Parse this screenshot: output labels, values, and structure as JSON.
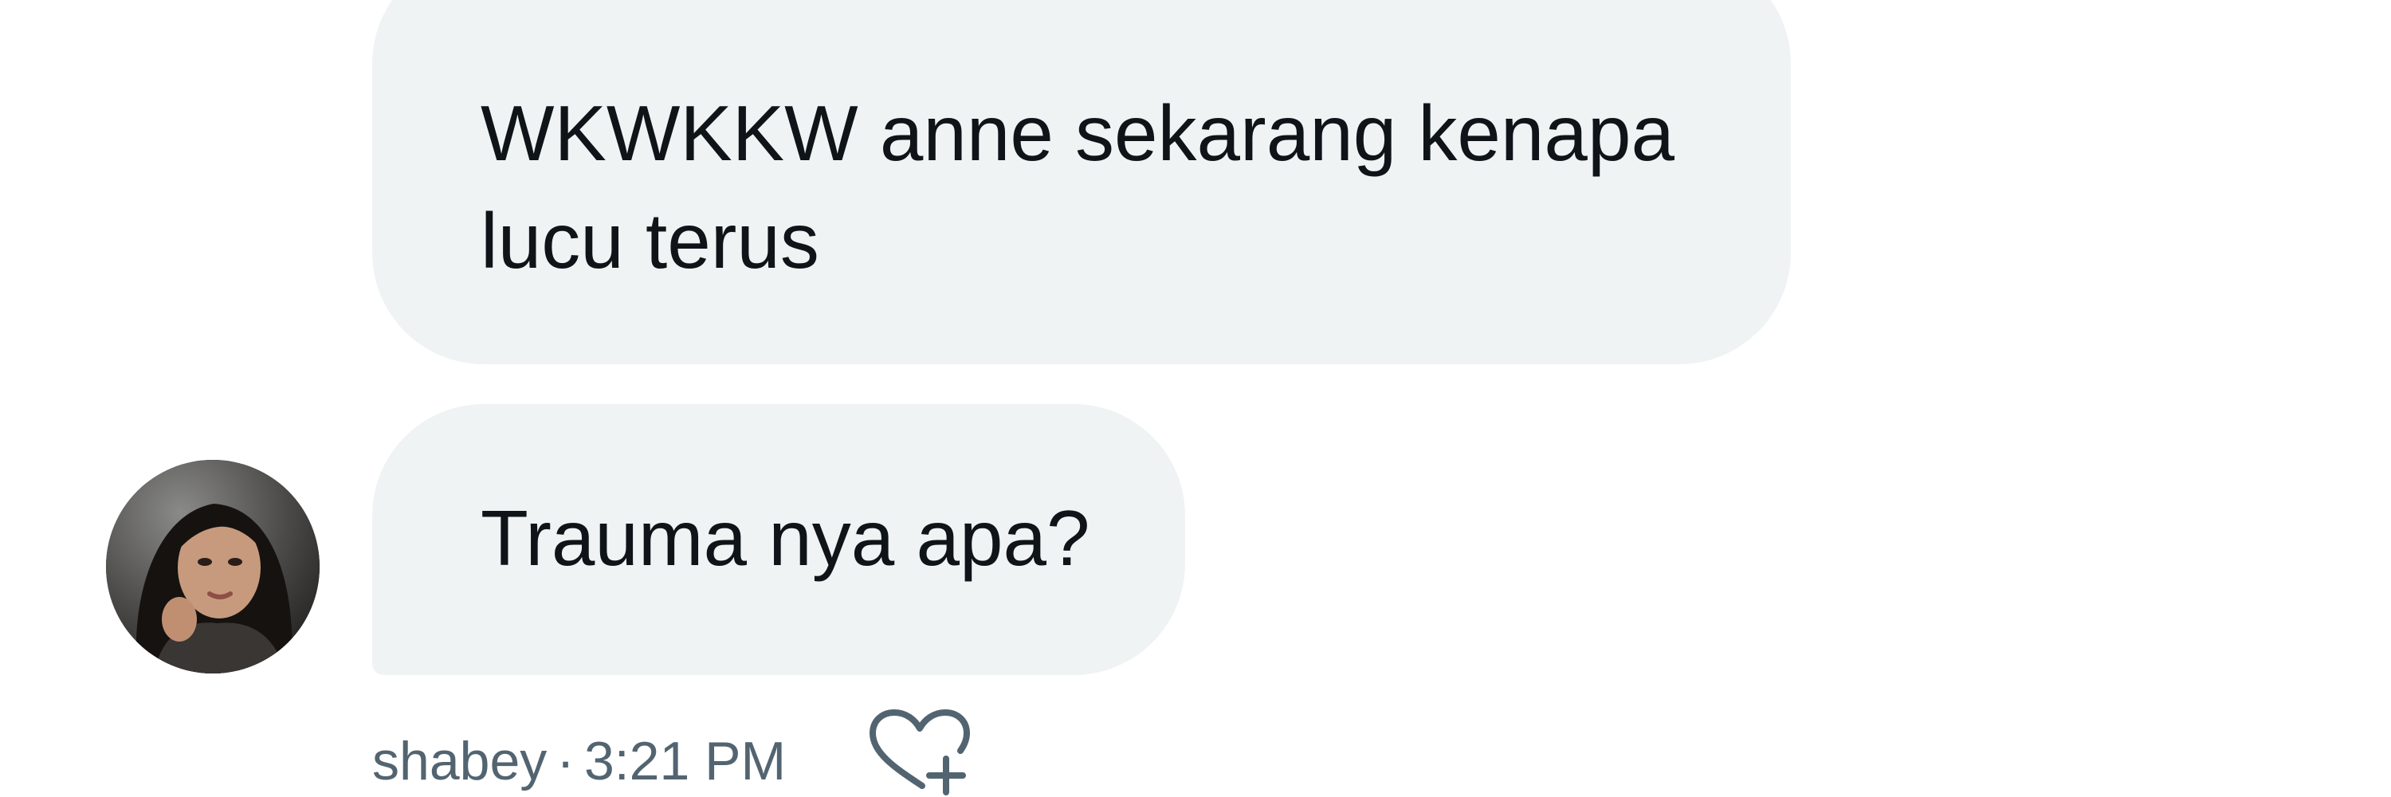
{
  "messages": [
    {
      "text": "WKWKKW anne sekarang kenapa lucu terus"
    },
    {
      "text": "Trauma nya apa?"
    }
  ],
  "meta": {
    "sender": "shabey",
    "separator": "·",
    "time": "3:21 PM"
  },
  "icons": {
    "avatar": "avatar",
    "reaction": "heart-plus-icon"
  },
  "colors": {
    "bubble_bg": "#eff3f4",
    "message_text": "#0f1419",
    "meta_text": "#536471"
  }
}
